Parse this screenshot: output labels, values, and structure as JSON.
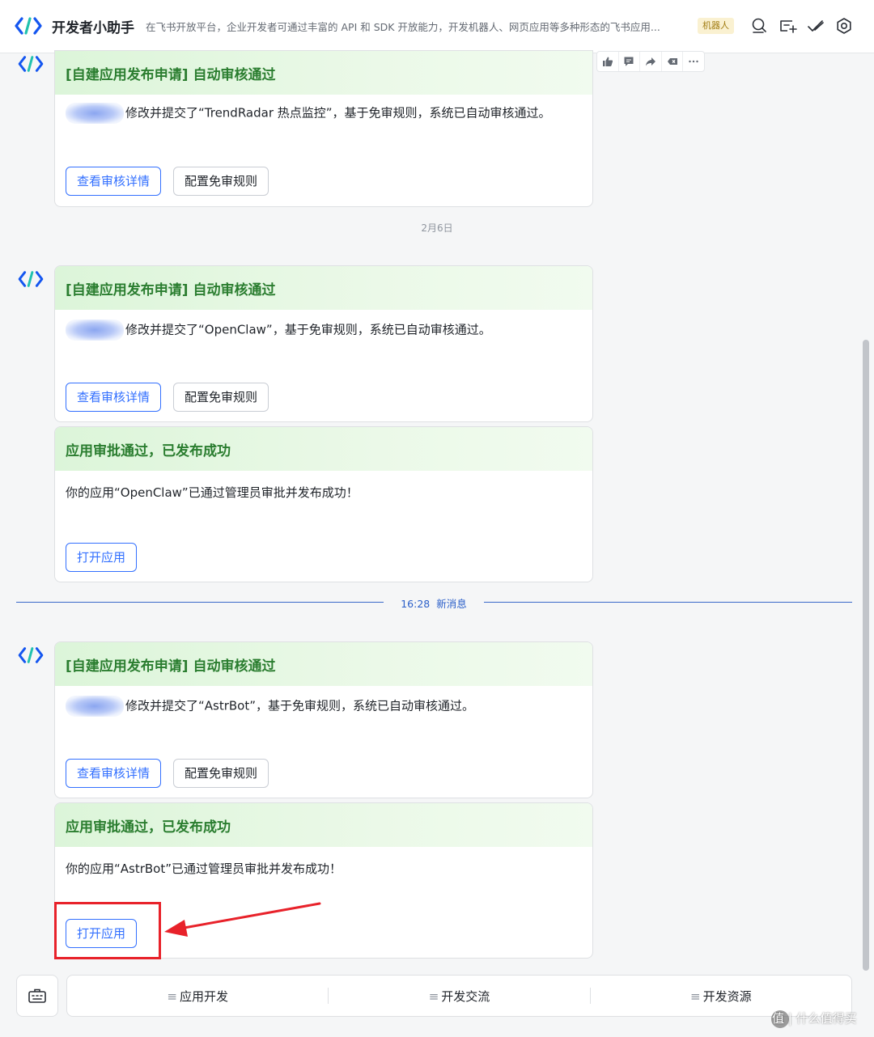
{
  "header": {
    "title": "开发者小助手",
    "description": "在飞书开放平台，企业开发者可通过丰富的 API 和 SDK 开放能力，开发机器人、网页应用等多种形态的飞书应用...",
    "badge": "机器人",
    "icons": [
      "search-icon",
      "add-chat-icon",
      "done-check-icon",
      "settings-gear-icon"
    ]
  },
  "message_toolbar": [
    "thumbs-up-icon",
    "comment-icon",
    "forward-icon",
    "delete-icon",
    "more-icon"
  ],
  "date_separator": "2月6日",
  "new_message_divider": {
    "time": "16:28",
    "label": "新消息"
  },
  "cards": [
    {
      "title": "[自建应用发布申请] 自动审核通过",
      "text": "修改并提交了“TrendRadar 热点监控”，基于免审规则，系统已自动审核通过。",
      "buttons": [
        "查看审核详情",
        "配置免审规则"
      ]
    },
    {
      "title": "[自建应用发布申请] 自动审核通过",
      "text": "修改并提交了“OpenClaw”，基于免审规则，系统已自动审核通过。",
      "buttons": [
        "查看审核详情",
        "配置免审规则"
      ]
    },
    {
      "title": "应用审批通过，已发布成功",
      "text": "你的应用“OpenClaw”已通过管理员审批并发布成功！",
      "buttons": [
        "打开应用"
      ]
    },
    {
      "title": "[自建应用发布申请] 自动审核通过",
      "text": "修改并提交了“AstrBot”，基于免审规则，系统已自动审核通过。",
      "buttons": [
        "查看审核详情",
        "配置免审规则"
      ]
    },
    {
      "title": "应用审批通过，已发布成功",
      "text": "你的应用“AstrBot”已通过管理员审批并发布成功！",
      "buttons": [
        "打开应用"
      ]
    }
  ],
  "bottom_menu": {
    "items": [
      "应用开发",
      "开发交流",
      "开发资源"
    ],
    "keyboard_icon": "keyboard-icon"
  },
  "annotation": {
    "color": "#e8222a"
  },
  "watermark": "值 | 什么值得买",
  "colors": {
    "accent": "#3370ff",
    "card_title": "#2a7d2f",
    "card_header_bg": "#dcf5d9"
  }
}
